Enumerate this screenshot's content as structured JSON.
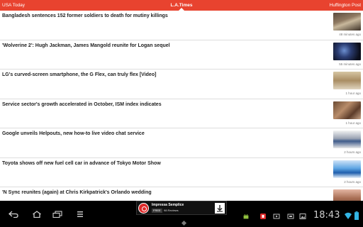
{
  "tabs": {
    "left": "USA Today",
    "center": "L.A.Times",
    "right": "Huffington Post"
  },
  "articles": [
    {
      "headline": "Bangladesh sentences 152 former soldiers to death for mutiny killings",
      "time": "48 minutes ago",
      "thumb": "soldiers-photo"
    },
    {
      "headline": "'Wolverine 2': Hugh Jackman, James Mangold reunite for Logan sequel",
      "time": "55 minutes ago",
      "thumb": "wolverine-photo"
    },
    {
      "headline": "LG's curved-screen smartphone, the G Flex, can truly flex [Video]",
      "time": "1 hour ago",
      "thumb": "phone-photo"
    },
    {
      "headline": "Service sector's growth accelerated in October, ISM index indicates",
      "time": "1 hour ago",
      "thumb": "office-photo"
    },
    {
      "headline": "Google unveils Helpouts, new how-to live video chat service",
      "time": "2 hours ago",
      "thumb": "helpouts-screenshot"
    },
    {
      "headline": "Toyota shows off new fuel cell car in advance of Tokyo Motor Show",
      "time": "2 hours ago",
      "thumb": "car-photo"
    },
    {
      "headline": "'N Sync reunites (again) at Chris Kirkpatrick's Orlando wedding",
      "time": "",
      "thumb": "wedding-photo"
    }
  ],
  "ad": {
    "title": "Impressa Semplice",
    "badge": "FREE",
    "reviews": "98 Reviews"
  },
  "status_bar": {
    "clock": "18:43"
  },
  "colors": {
    "accent": "#e8432f",
    "system_bar": "#000000"
  }
}
